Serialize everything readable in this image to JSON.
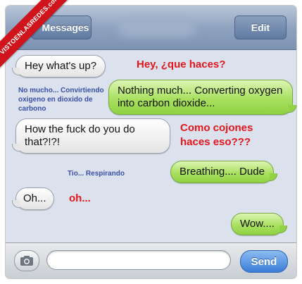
{
  "navbar": {
    "back_label": "Messages",
    "edit_label": "Edit"
  },
  "watermark": {
    "text": "VISTOENLASREDES.com"
  },
  "messages": [
    {
      "side": "in",
      "text": "Hey what's up?"
    },
    {
      "side": "out",
      "text": "Nothing much... Converting oxygen into carbon dioxide..."
    },
    {
      "side": "in",
      "text": "How the fuck do you do that?!?!"
    },
    {
      "side": "out",
      "text": "Breathing.... Dude"
    },
    {
      "side": "in",
      "text": "Oh..."
    },
    {
      "side": "out",
      "text": "Wow...."
    }
  ],
  "translations": {
    "t1": "Hey, ¿que haces?",
    "t2": "No mucho... Convirtiendo oxigeno en dioxido de carbono",
    "t3": "Como cojones haces eso???",
    "t4": "Tio... Respirando",
    "t5": "oh..."
  },
  "inputbar": {
    "placeholder": "",
    "send_label": "Send"
  },
  "colors": {
    "translation_red": "#e2161c",
    "translation_blue": "#3a4fa8",
    "out_bubble": "#a9e060",
    "send_button": "#3a7ed8"
  }
}
